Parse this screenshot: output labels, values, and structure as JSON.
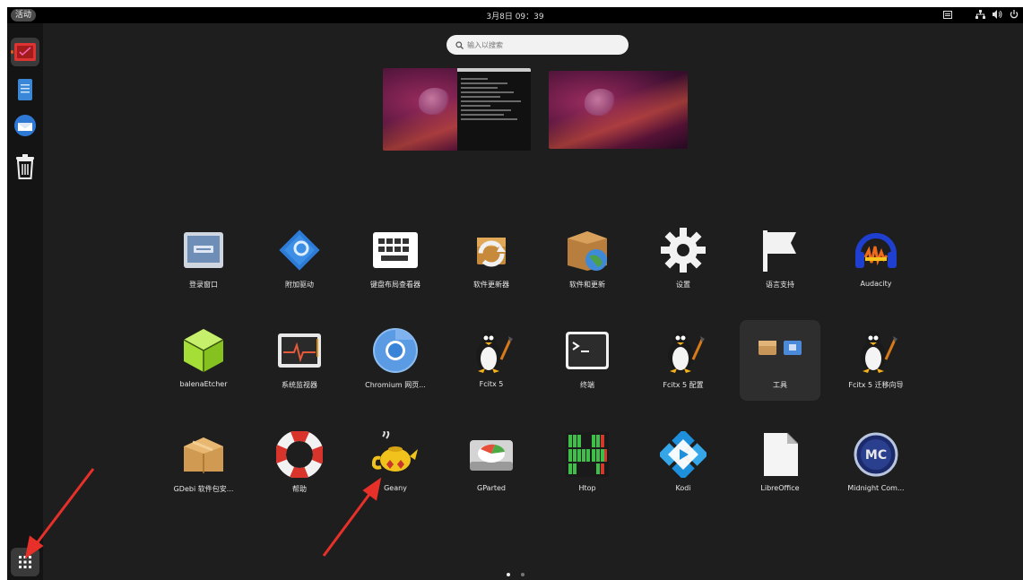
{
  "topbar": {
    "activities": "活动",
    "clock": "3月8日 09：39"
  },
  "search": {
    "placeholder": "输入以搜索"
  },
  "dock": {
    "items": [
      {
        "name": "ubuntu-software-icon"
      },
      {
        "name": "text-editor-icon"
      },
      {
        "name": "thunderbird-icon"
      },
      {
        "name": "trash-icon"
      }
    ],
    "show_apps_label": "显示应用程序"
  },
  "apps": [
    {
      "label": "登录窗口",
      "icon": "login-window-icon"
    },
    {
      "label": "附加驱动",
      "icon": "additional-drivers-icon"
    },
    {
      "label": "键盘布局查看器",
      "icon": "keyboard-icon"
    },
    {
      "label": "软件更新器",
      "icon": "software-updater-icon"
    },
    {
      "label": "软件和更新",
      "icon": "software-sources-icon"
    },
    {
      "label": "设置",
      "icon": "settings-gear-icon"
    },
    {
      "label": "语言支持",
      "icon": "language-flag-icon"
    },
    {
      "label": "Audacity",
      "icon": "audacity-icon"
    },
    {
      "label": "balenaEtcher",
      "icon": "balena-etcher-icon"
    },
    {
      "label": "系统监视器",
      "icon": "system-monitor-icon"
    },
    {
      "label": "Chromium 网页...",
      "icon": "chromium-icon"
    },
    {
      "label": "Fcitx 5",
      "icon": "fcitx-penguin-icon"
    },
    {
      "label": "终端",
      "icon": "terminal-icon"
    },
    {
      "label": "Fcitx 5 配置",
      "icon": "fcitx-config-penguin-icon"
    },
    {
      "label": "工具",
      "icon": "tools-folder-icon"
    },
    {
      "label": "Fcitx 5 迁移向导",
      "icon": "fcitx-migrator-penguin-icon"
    },
    {
      "label": "GDebi 软件包安...",
      "icon": "gdebi-box-icon"
    },
    {
      "label": "帮助",
      "icon": "help-lifebuoy-icon"
    },
    {
      "label": "Geany",
      "icon": "geany-teapot-icon"
    },
    {
      "label": "GParted",
      "icon": "gparted-disk-icon"
    },
    {
      "label": "Htop",
      "icon": "htop-icon"
    },
    {
      "label": "Kodi",
      "icon": "kodi-icon"
    },
    {
      "label": "LibreOffice",
      "icon": "libreoffice-icon"
    },
    {
      "label": "Midnight Com...",
      "icon": "midnight-commander-icon"
    }
  ],
  "pager": {
    "pages": 2,
    "current": 1
  },
  "colors": {
    "annotation_arrow": "#e8302a",
    "accent": "#e8541a"
  }
}
